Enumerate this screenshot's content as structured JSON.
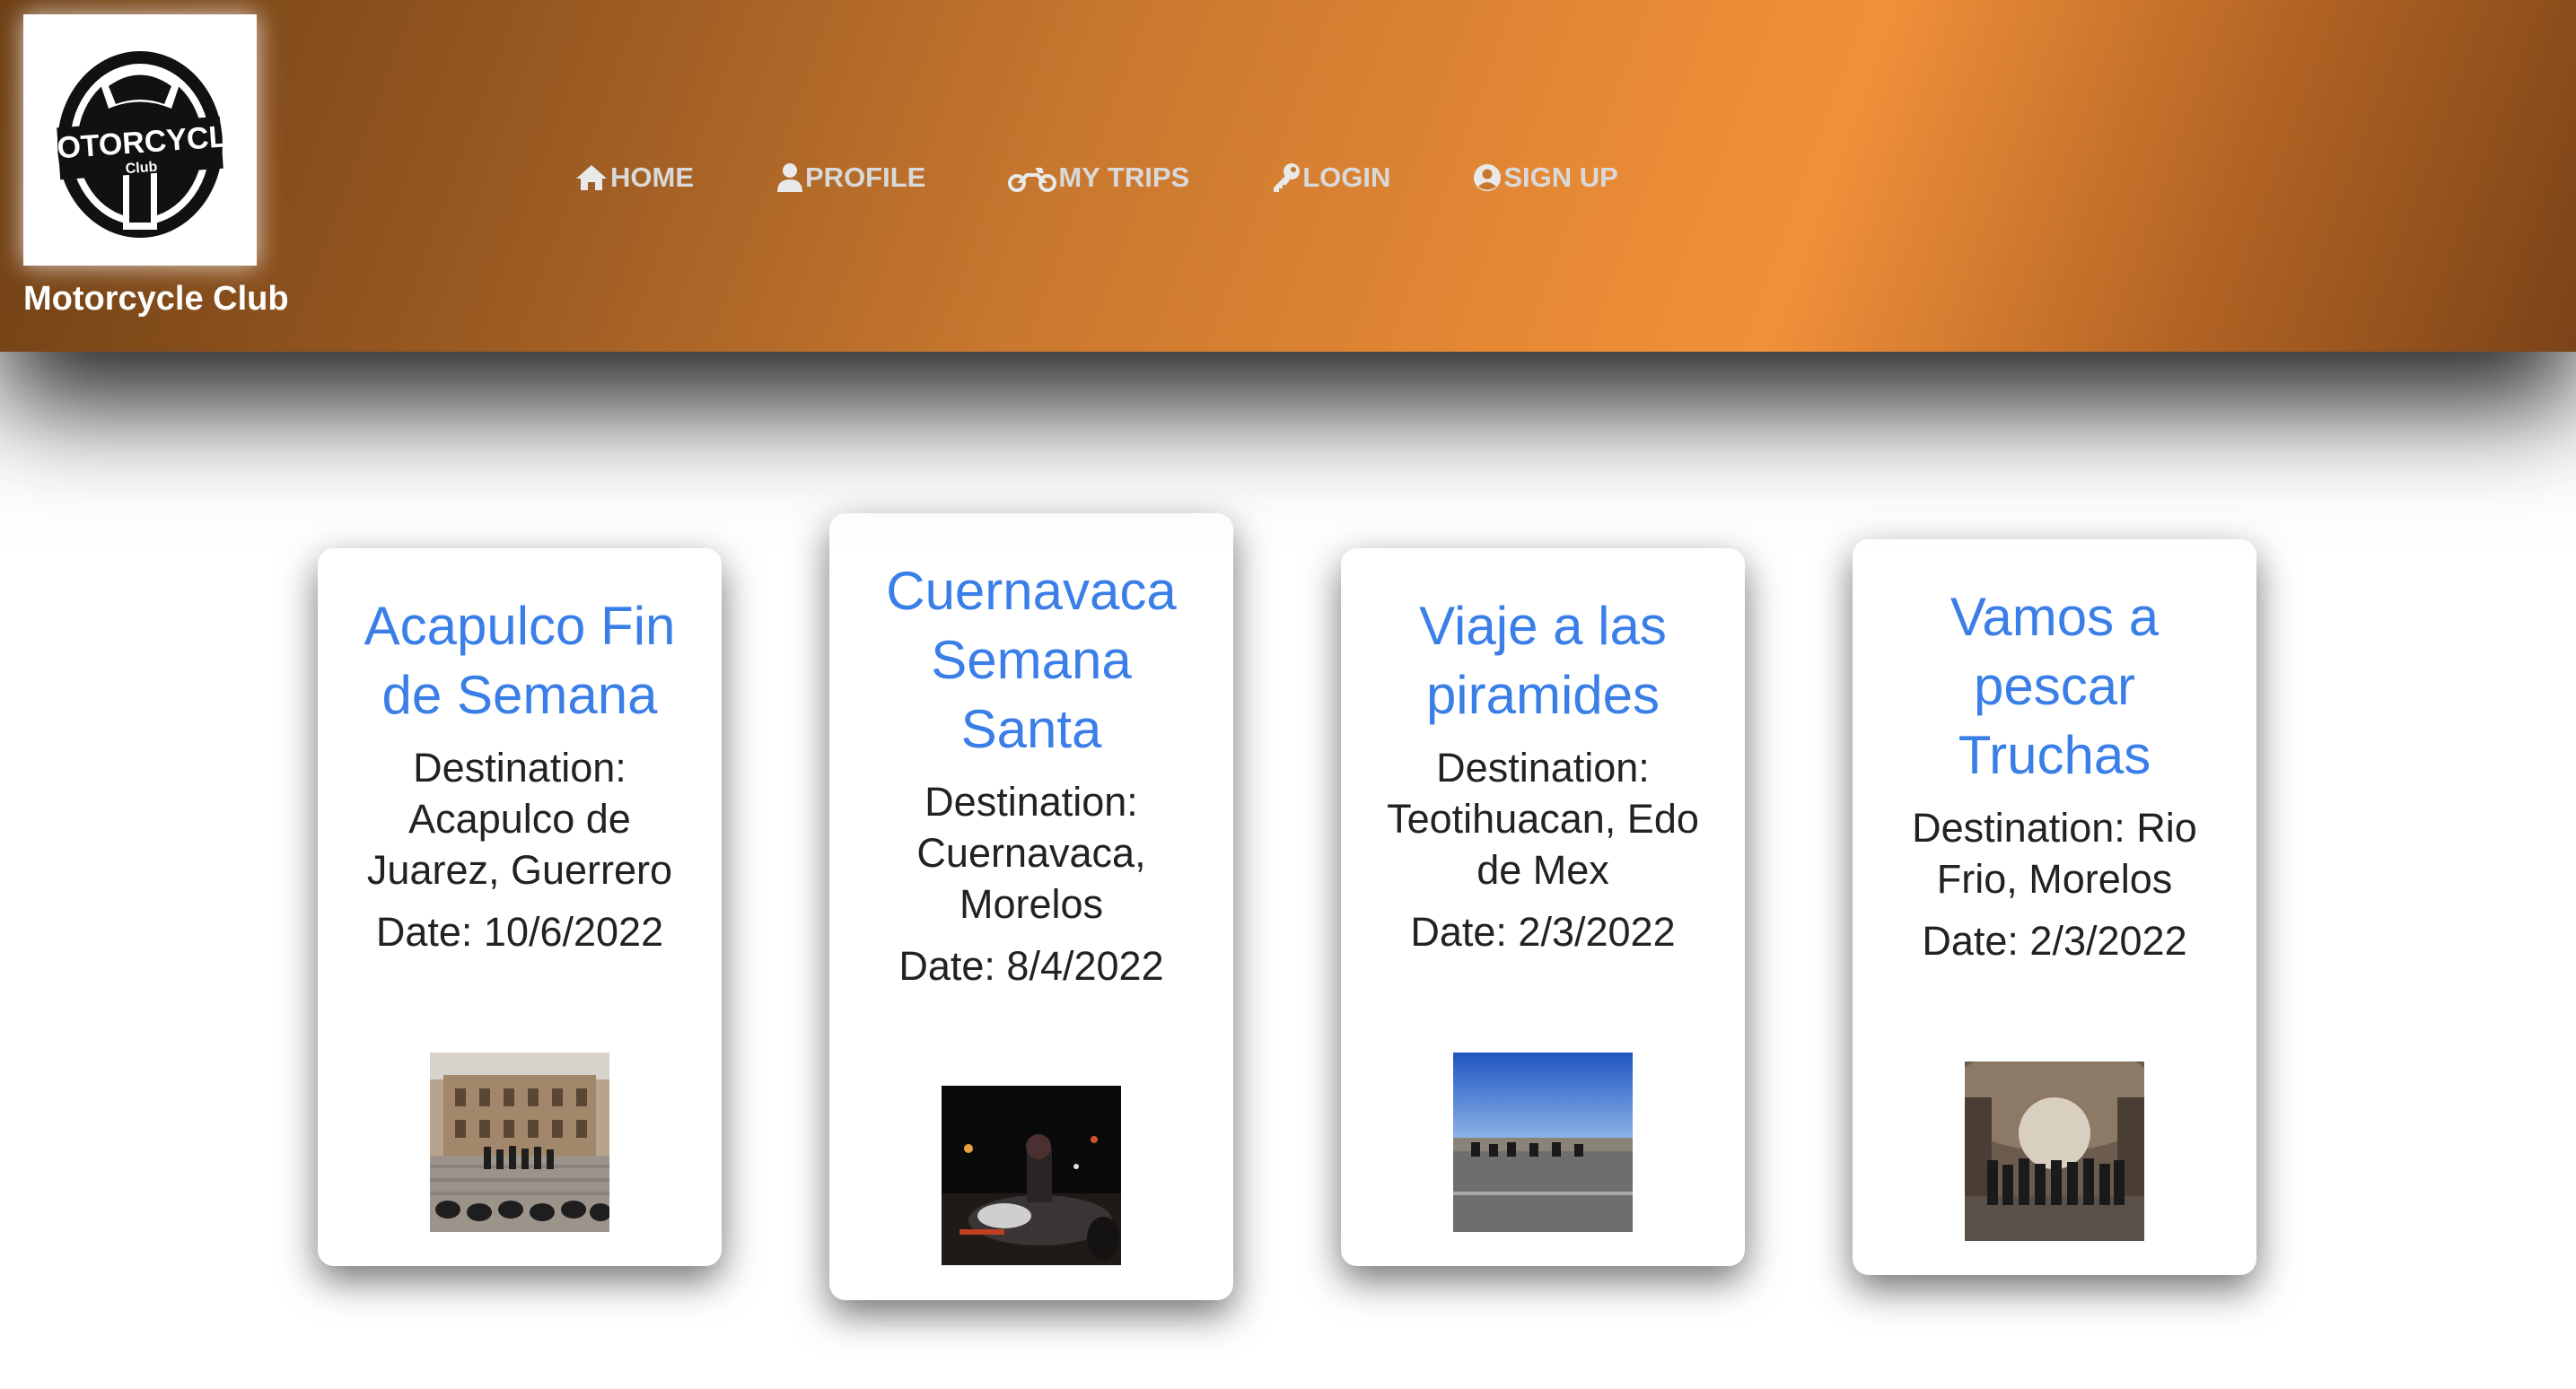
{
  "brand": {
    "name": "Motorcycle Club",
    "logo_text_main": "MOTORCYCLE",
    "logo_text_sub": "Club",
    "icon": "motorcycle-club-logo"
  },
  "nav": {
    "items": [
      {
        "label": "HOME",
        "icon": "home-icon"
      },
      {
        "label": "PROFILE",
        "icon": "user-icon"
      },
      {
        "label": "MY TRIPS",
        "icon": "motorcycle-icon"
      },
      {
        "label": "LOGIN",
        "icon": "key-icon"
      },
      {
        "label": "SIGN UP",
        "icon": "user-circle-icon"
      }
    ]
  },
  "colors": {
    "title_blue": "#3a7ee8",
    "header_orange": "#e88a35",
    "header_brown": "#6e3f14"
  },
  "trips": [
    {
      "title": "Acapulco Fin de Semana",
      "destination": "Destination: Acapulco de Juarez, Guerrero",
      "date": "Date: 10/6/2022",
      "photo": "group-at-stone-building-photo"
    },
    {
      "title": "Cuernavaca Semana Santa",
      "destination": "Destination: Cuernavaca, Morelos",
      "date": "Date: 8/4/2022",
      "photo": "night-rider-photo"
    },
    {
      "title": "Viaje a las piramides",
      "destination": "Destination: Teotihuacan, Edo de Mex",
      "date": "Date: 2/3/2022",
      "photo": "road-blue-sky-photo"
    },
    {
      "title": "Vamos a pescar Truchas",
      "destination": "Destination: Rio Frio, Morelos",
      "date": "Date: 2/3/2022",
      "photo": "group-in-tunnel-photo"
    }
  ]
}
